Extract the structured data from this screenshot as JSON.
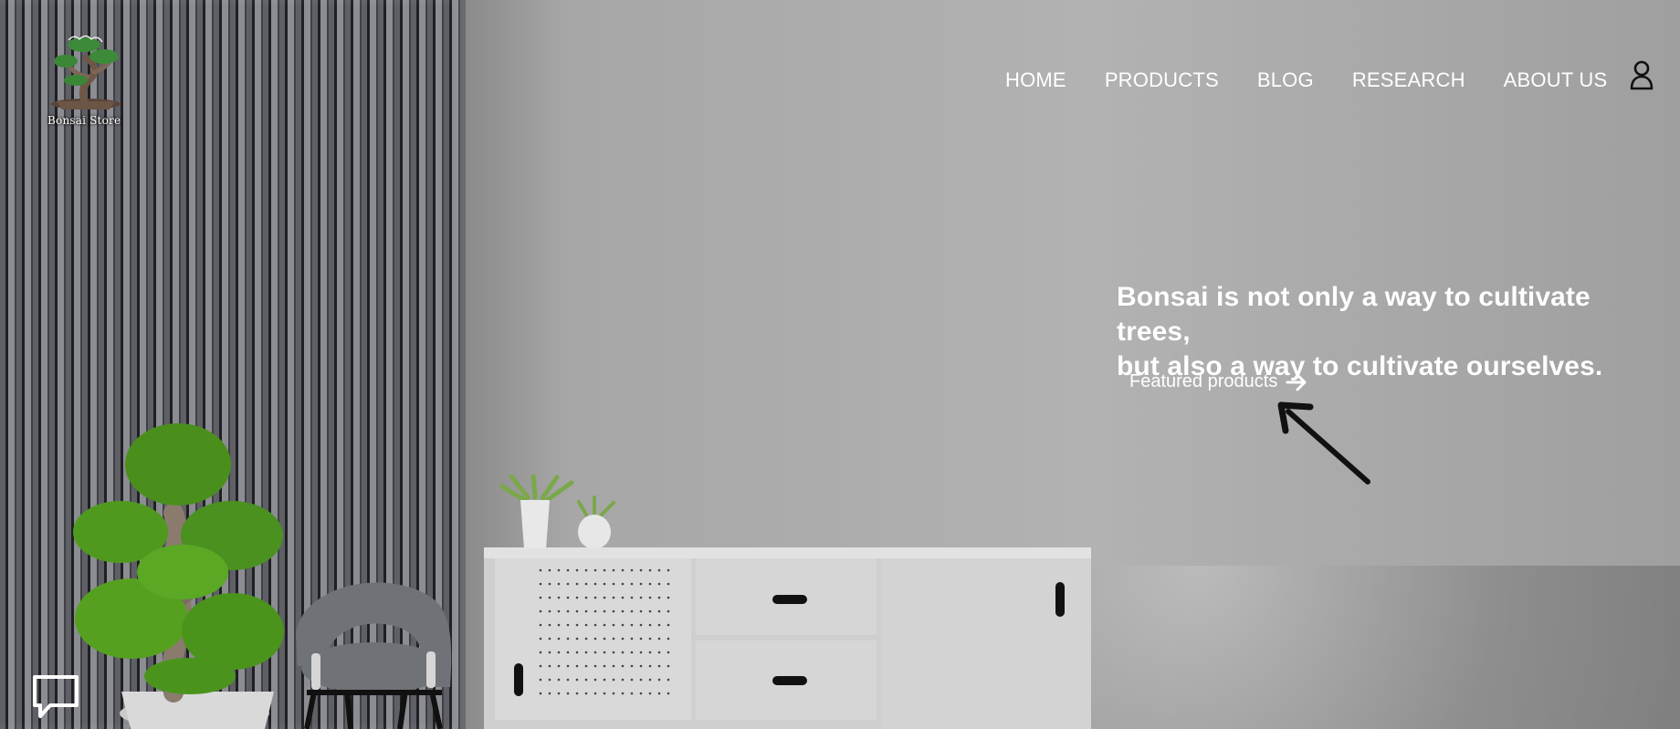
{
  "brand": {
    "logo_text": "Bonsai Store"
  },
  "nav": {
    "items": [
      {
        "label": "HOME"
      },
      {
        "label": "PRODUCTS"
      },
      {
        "label": "BLOG"
      },
      {
        "label": "RESEARCH"
      },
      {
        "label": "ABOUT US"
      }
    ]
  },
  "hero": {
    "quote_line_1": "Bonsai is not only a way to cultivate trees,",
    "quote_line_2": "but also a way to cultivate ourselves.",
    "cta_label": "Featured products"
  },
  "icons": {
    "user": "user-icon",
    "chat": "chat-icon",
    "arrow_right": "arrow-right-icon",
    "cursor_arrow": "hand-arrow-icon"
  },
  "colors": {
    "background": "#a6a6a6",
    "text": "#ffffff",
    "dark": "#111111",
    "plant_green": "#4f9a1e"
  }
}
